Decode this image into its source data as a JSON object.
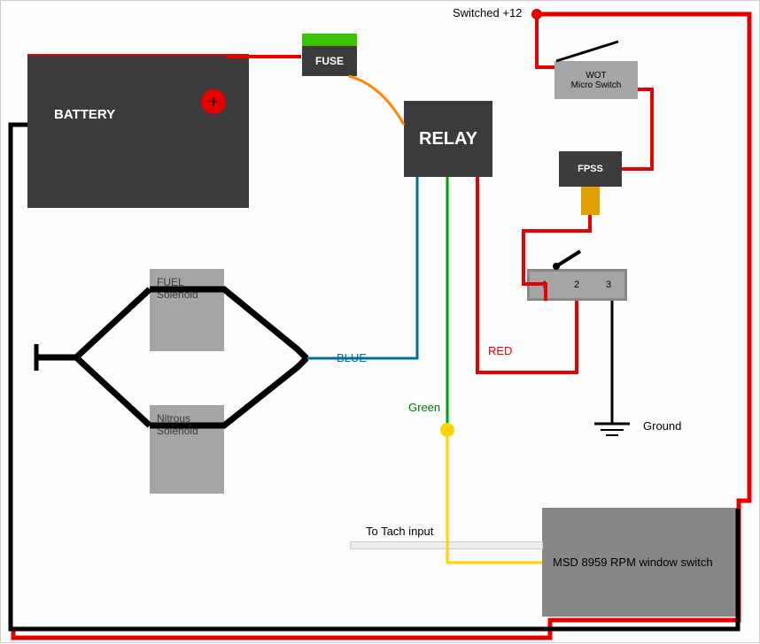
{
  "components": {
    "battery": {
      "label": "BATTERY",
      "terminal_symbol": "+"
    },
    "fuse": {
      "label": "FUSE"
    },
    "relay": {
      "label": "RELAY"
    },
    "fuel_solenoid": {
      "label_line1": "FUEL",
      "label_line2": "Solenoid"
    },
    "nitrous_solenoid": {
      "label_line1": "Nitrous",
      "label_line2": "Solenoid"
    },
    "wot_switch": {
      "label_line1": "WOT",
      "label_line2": "Micro Switch"
    },
    "fpss": {
      "label": "FPSS"
    },
    "toggle_switch": {
      "terminal_1": "1",
      "terminal_2": "2",
      "terminal_3": "3"
    },
    "msd_rpm_switch": {
      "label": "MSD 8959 RPM window switch"
    }
  },
  "wires": {
    "switched_12": {
      "label": "Switched +12",
      "color": "#e60000"
    },
    "blue": {
      "label": "BLUE",
      "color": "#006d9e"
    },
    "green": {
      "label": "Green",
      "color": "#00a000"
    },
    "red": {
      "label": "RED",
      "color": "#e60000"
    },
    "ground": {
      "label": "Ground",
      "color": "#000000"
    },
    "tach": {
      "label": "To Tach input",
      "color": "#888888"
    },
    "yellow": {
      "color": "#ffd400"
    },
    "orange": {
      "color": "#ff8a00"
    }
  }
}
